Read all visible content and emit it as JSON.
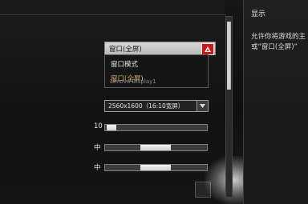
{
  "help": {
    "title": "显示",
    "text": "允许你将游戏的主\n或“窗口(全屏)”"
  },
  "display_mode": {
    "selected": "窗口(全屏)",
    "options": [
      "窗口模式",
      "窗口(全屏)"
    ],
    "ghost_option": "Lenovo Display1"
  },
  "resolution": {
    "value": "2560x1600（16:10宽屏）"
  },
  "sliders": [
    {
      "label": "10",
      "level": 0.08
    },
    {
      "label": "中",
      "level": 0.5
    },
    {
      "label": "中",
      "level": 0.5
    }
  ],
  "colors": {
    "accent_red": "#c91a1a",
    "selected_text": "#d9b06a"
  },
  "icons": [
    "triangle-up-icon",
    "triangle-down-icon"
  ]
}
